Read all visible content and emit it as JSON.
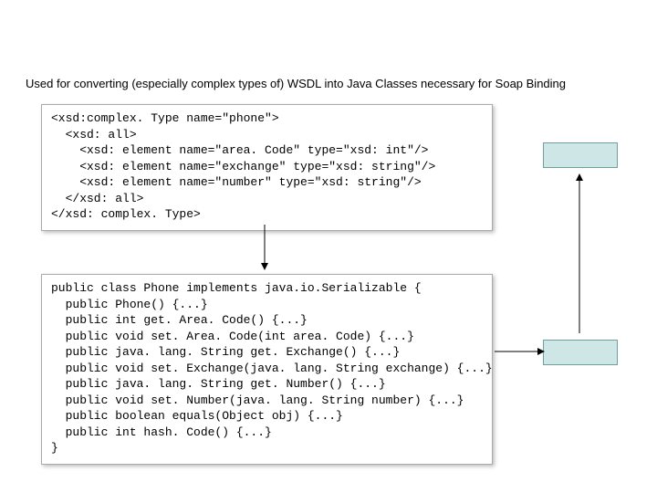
{
  "heading": "Used for converting (especially complex types of) WSDL into Java Classes necessary for Soap Binding",
  "xsd_code": "<xsd:complex. Type name=\"phone\">\n  <xsd: all>\n    <xsd: element name=\"area. Code\" type=\"xsd: int\"/>\n    <xsd: element name=\"exchange\" type=\"xsd: string\"/>\n    <xsd: element name=\"number\" type=\"xsd: string\"/>\n  </xsd: all>\n</xsd: complex. Type>",
  "java_code": "public class Phone implements java.io.Serializable {\n  public Phone() {...}\n  public int get. Area. Code() {...}\n  public void set. Area. Code(int area. Code) {...}\n  public java. lang. String get. Exchange() {...}\n  public void set. Exchange(java. lang. String exchange) {...}\n  public java. lang. String get. Number() {...}\n  public void set. Number(java. lang. String number) {...}\n  public boolean equals(Object obj) {...}\n  public int hash. Code() {...}\n}"
}
